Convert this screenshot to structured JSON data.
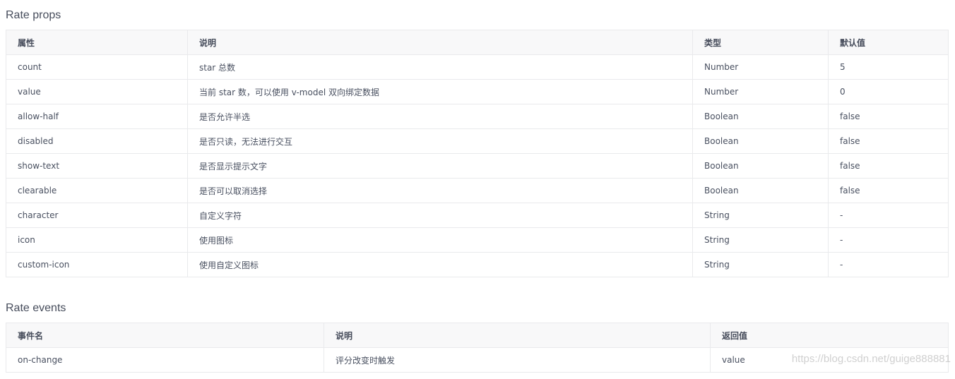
{
  "props": {
    "title": "Rate props",
    "headers": [
      "属性",
      "说明",
      "类型",
      "默认值"
    ],
    "rows": [
      {
        "name": "count",
        "desc": "star 总数",
        "type": "Number",
        "default": "5"
      },
      {
        "name": "value",
        "desc": "当前 star 数，可以使用 v-model 双向绑定数据",
        "type": "Number",
        "default": "0"
      },
      {
        "name": "allow-half",
        "desc": "是否允许半选",
        "type": "Boolean",
        "default": "false"
      },
      {
        "name": "disabled",
        "desc": "是否只读，无法进行交互",
        "type": "Boolean",
        "default": "false"
      },
      {
        "name": "show-text",
        "desc": "是否显示提示文字",
        "type": "Boolean",
        "default": "false"
      },
      {
        "name": "clearable",
        "desc": "是否可以取消选择",
        "type": "Boolean",
        "default": "false"
      },
      {
        "name": "character",
        "desc": "自定义字符",
        "type": "String",
        "default": "-"
      },
      {
        "name": "icon",
        "desc": "使用图标",
        "type": "String",
        "default": "-"
      },
      {
        "name": "custom-icon",
        "desc": "使用自定义图标",
        "type": "String",
        "default": "-"
      }
    ]
  },
  "events": {
    "title": "Rate events",
    "headers": [
      "事件名",
      "说明",
      "返回值"
    ],
    "rows": [
      {
        "name": "on-change",
        "desc": "评分改变时触发",
        "returns": "value"
      }
    ]
  },
  "watermark": "https://blog.csdn.net/guige888881"
}
